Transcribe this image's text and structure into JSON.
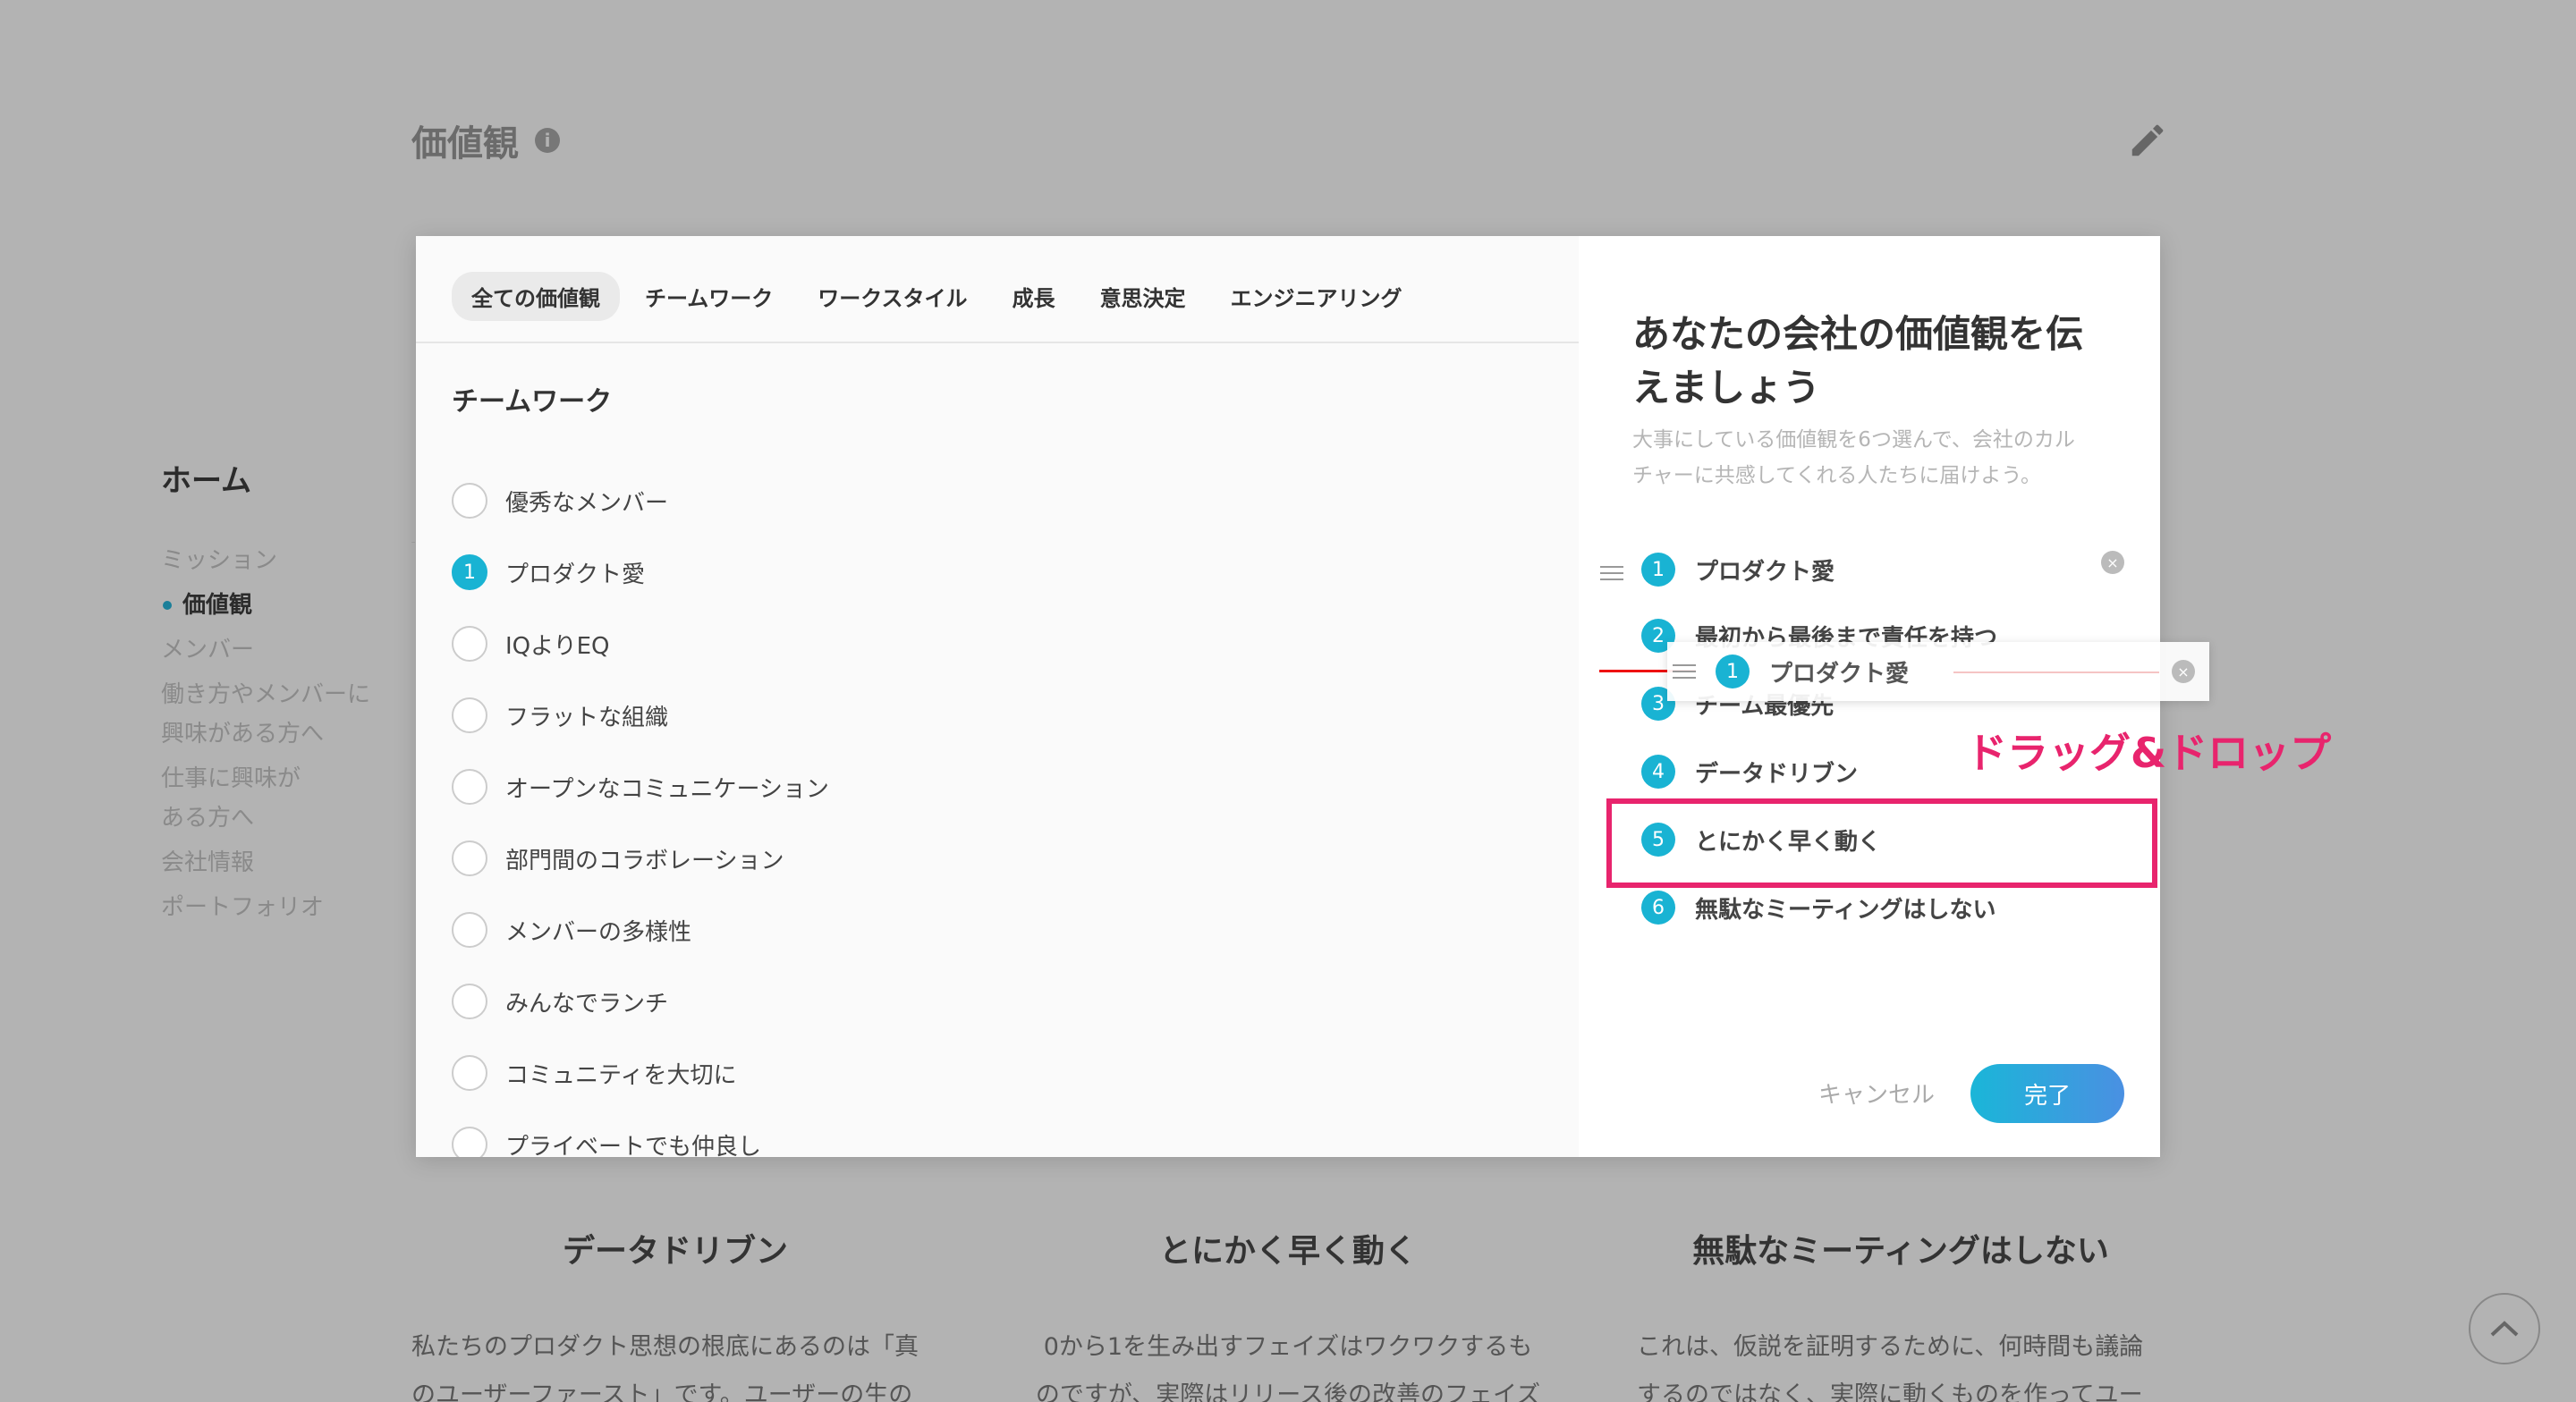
{
  "background": {
    "page_title": "価値観",
    "info_icon": "i",
    "nav": {
      "home": "ホーム",
      "items": [
        "ミッション",
        "価値観",
        "メンバー",
        "働き方やメンバーに",
        "興味がある方へ",
        "仕事に興味が",
        "ある方へ",
        "会社情報",
        "ポートフォリオ"
      ]
    },
    "cards": [
      {
        "title": "データドリブン",
        "body": [
          "私たちのプロダクト思想の根底にあるのは「真",
          "のユーザーファースト」です。ユーザーの生の"
        ]
      },
      {
        "title": "とにかく早く動く",
        "body": [
          "0から1を生み出すフェイズはワクワクするも",
          "のですが、実際はリリース後の改善のフェイズ"
        ]
      },
      {
        "title": "無駄なミーティングはしない",
        "body": [
          "これは、仮説を証明するために、何時間も議論",
          "するのではなく、実際に動くものを作ってユー"
        ]
      }
    ]
  },
  "modal": {
    "tabs": [
      "全ての価値観",
      "チームワーク",
      "ワークスタイル",
      "成長",
      "意思決定",
      "エンジニアリング"
    ],
    "active_tab": "全ての価値観",
    "section_title": "チームワーク",
    "values": [
      {
        "label": "優秀なメンバー",
        "selected": false,
        "number": ""
      },
      {
        "label": "プロダクト愛",
        "selected": true,
        "number": "1"
      },
      {
        "label": "IQよりEQ",
        "selected": false,
        "number": ""
      },
      {
        "label": "フラットな組織",
        "selected": false,
        "number": ""
      },
      {
        "label": "オープンなコミュニケーション",
        "selected": false,
        "number": ""
      },
      {
        "label": "部門間のコラボレーション",
        "selected": false,
        "number": ""
      },
      {
        "label": "メンバーの多様性",
        "selected": false,
        "number": ""
      },
      {
        "label": "みんなでランチ",
        "selected": false,
        "number": ""
      },
      {
        "label": "コミュニティを大切に",
        "selected": false,
        "number": ""
      },
      {
        "label": "プライベートでも仲良し",
        "selected": false,
        "number": ""
      }
    ],
    "right": {
      "title_line1": "あなたの会社の価値観を伝",
      "title_line2": "えましょう",
      "desc_line1": "大事にしている価値観を6つ選んで、会社のカル",
      "desc_line2": "チャーに共感してくれる人たちに届けよう。",
      "selected": [
        {
          "number": "1",
          "label": "プロダクト愛"
        },
        {
          "number": "2",
          "label": "最初から最後まで責任を持つ"
        },
        {
          "number": "3",
          "label": "チーム最優先"
        },
        {
          "number": "4",
          "label": "データドリブン"
        },
        {
          "number": "5",
          "label": "とにかく早く動く"
        },
        {
          "number": "6",
          "label": "無駄なミーティングはしない"
        }
      ],
      "remove_icon": "×",
      "cancel_label": "キャンセル",
      "done_label": "完了"
    }
  },
  "drag": {
    "ghost_number": "1",
    "ghost_label": "プロダクト愛",
    "annotation": "ドラッグ&ドロップ"
  },
  "colors": {
    "accent": "#19b3d3",
    "annotation": "#e8246d",
    "overlay": "#b3b3b3"
  }
}
